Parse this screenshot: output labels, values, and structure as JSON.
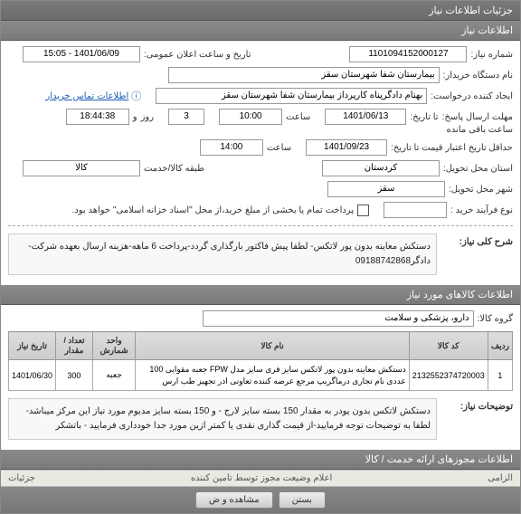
{
  "headers": {
    "top": "جزئیات اطلاعات نیاز",
    "info": "اطلاعات نیاز",
    "goods": "اطلاعات کالاهای مورد نیاز",
    "permits": "اطلاعات مجوزهای ارائه خدمت / کالا"
  },
  "labels": {
    "need_no": "شماره نیاز:",
    "announce_dt": "تاریخ و ساعت اعلان عمومی:",
    "buyer": "نام دستگاه خریدار:",
    "creator": "ایجاد کننده درخواست:",
    "contact": "اطلاعات تماس خریدار",
    "send_deadline": "مهلت ارسال پاسخ:",
    "time": "ساعت",
    "day": "روز",
    "remain": "ساعت باقی مانده",
    "valid_date": "حداقل تاریخ اعتبار قیمت تا تاریخ:",
    "province_need": "استان محل تحویل:",
    "cat": "طبقه کالا/خدمت",
    "city": "شهر محل تحویل:",
    "ptype": "نوع فرآیند خرید :",
    "pay_note": "پرداخت تمام یا بخشی از مبلغ خرید،از محل \"اسناد خزانه اسلامی\" خواهد بود.",
    "main_desc": "شرح کلی نیاز:",
    "goods_group": "گروه کالا:",
    "extra_desc": "توضیحات نیاز:"
  },
  "fields": {
    "need_no": "1101094152000127",
    "announce_dt": "1401/06/09 - 15:05",
    "buyer": "بیمارستان شفا شهرستان سقز",
    "creator": "بهنام دادگرپناه کارپرداز بیمارستان شفا شهرستان سقز",
    "deadline_date": "1401/06/13",
    "deadline_time": "10:00",
    "deadline_days": "3",
    "deadline_remain": "18:44:38",
    "valid_date": "1401/09/23",
    "valid_time": "14:00",
    "province": "کردستان",
    "category": "کالا",
    "city": "سقز",
    "ptype_val": "",
    "main_desc_txt": "دستکش معاینه بدون پور لاتکس- لطفا پیش فاکتور بارگذاری گردد-پرداخت 6 ماهه-هزینه ارسال بعهده شرکت- دادگر09188742868",
    "goods_group_val": "دارو، پزشکی و سلامت",
    "extra_desc_txt": "دستکش لاتکس بدون پودر به مقدار 150 بسته سایز لارج - و 150 بسته سایز مدیوم مورد نیاز این مرکز میباشد-لطفا به توضیحات توجه فرمایید-از قیمت گذاری نقدی یا کمتر ازین مورد جدا خودداری فرمایید - باتشکر"
  },
  "checks": {
    "pay": false
  },
  "table": {
    "cols": [
      "ردیف",
      "کد کالا",
      "نام کالا",
      "واحد شمارش",
      "تعداد / مقدار",
      "تاریخ نیاز"
    ],
    "rows": [
      {
        "idx": "1",
        "code": "2132552374720003",
        "name": "دستکش معاینه بدون پور لاتکس سایز فری سایز مدل FPW جعبه مقوایی 100 عددی نام تجاری درماگریپ مرجع عرضه کننده تعاونی اذر تجهیز طب ارس",
        "unit": "جعبه",
        "qty": "300",
        "date": "1401/06/30"
      }
    ]
  },
  "footer": {
    "mandatory": "الزامی",
    "announce": "اعلام وضیعت مجوز توسط تامین کننده",
    "details": "جزئیات",
    "close": "بستن",
    "attach_title": "مشاهده و ض"
  }
}
